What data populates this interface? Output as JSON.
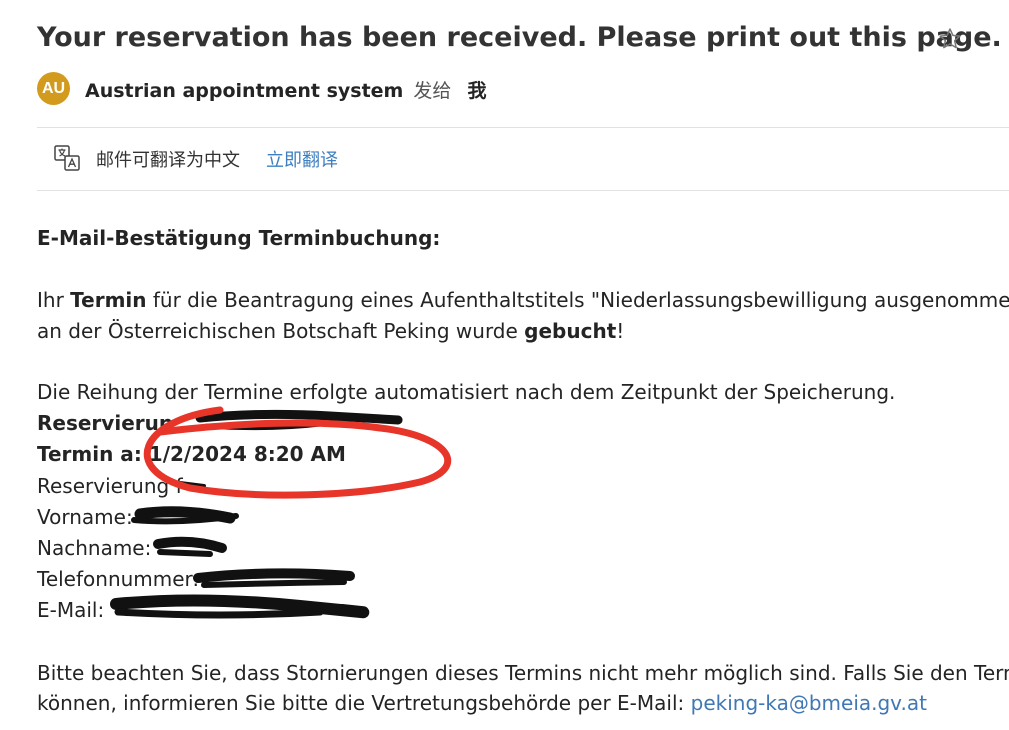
{
  "email": {
    "subject": "Your reservation has been received. Please print out this page.",
    "sender": {
      "initials": "AU",
      "name": "Austrian appointment system",
      "sent_to": "发给",
      "recipient": "我"
    },
    "translate": {
      "text": "邮件可翻译为中文",
      "action": "立即翻译"
    },
    "body": {
      "heading": "E-Mail-Bestätigung Terminbuchung:",
      "p1_part1": "Ihr ",
      "p1_termin": "Termin",
      "p1_part2": " für die Beantragung eines Aufenthaltstitels \"Niederlassungsbewilligung ausgenommen",
      "p2_part1": "an der Österreichischen Botschaft Peking wurde ",
      "p2_gebucht": "gebucht",
      "p2_part2": "!",
      "p3": "Die Reihung der Termine erfolgte automatisiert nach dem Zeitpunkt der Speicherung.",
      "reservation_label": "Reservierun",
      "appointment_label": "Termin a",
      "appointment_value": ": 1/2/2024 8:20 AM",
      "reserved_for_label": "Reservierung f",
      "firstname_label": "Vorname:",
      "lastname_label": "Nachname:",
      "phone_label": "Telefonnummer:",
      "email_label": "E-Mail:",
      "notice_line1": "Bitte beachten Sie, dass Stornierungen dieses Termins nicht mehr möglich sind. Falls Sie den Termin",
      "notice_line2_part": "können, informieren Sie bitte die Vertretungsbehörde per E-Mail: ",
      "notice_email": "peking-ka@bmeia.gv.at"
    }
  },
  "colors": {
    "avatar": "#d39b1e",
    "link": "#3f78b5",
    "annotation": "#e8352a",
    "redaction": "#111111"
  },
  "icons": [
    "star-icon",
    "translate-icon"
  ]
}
